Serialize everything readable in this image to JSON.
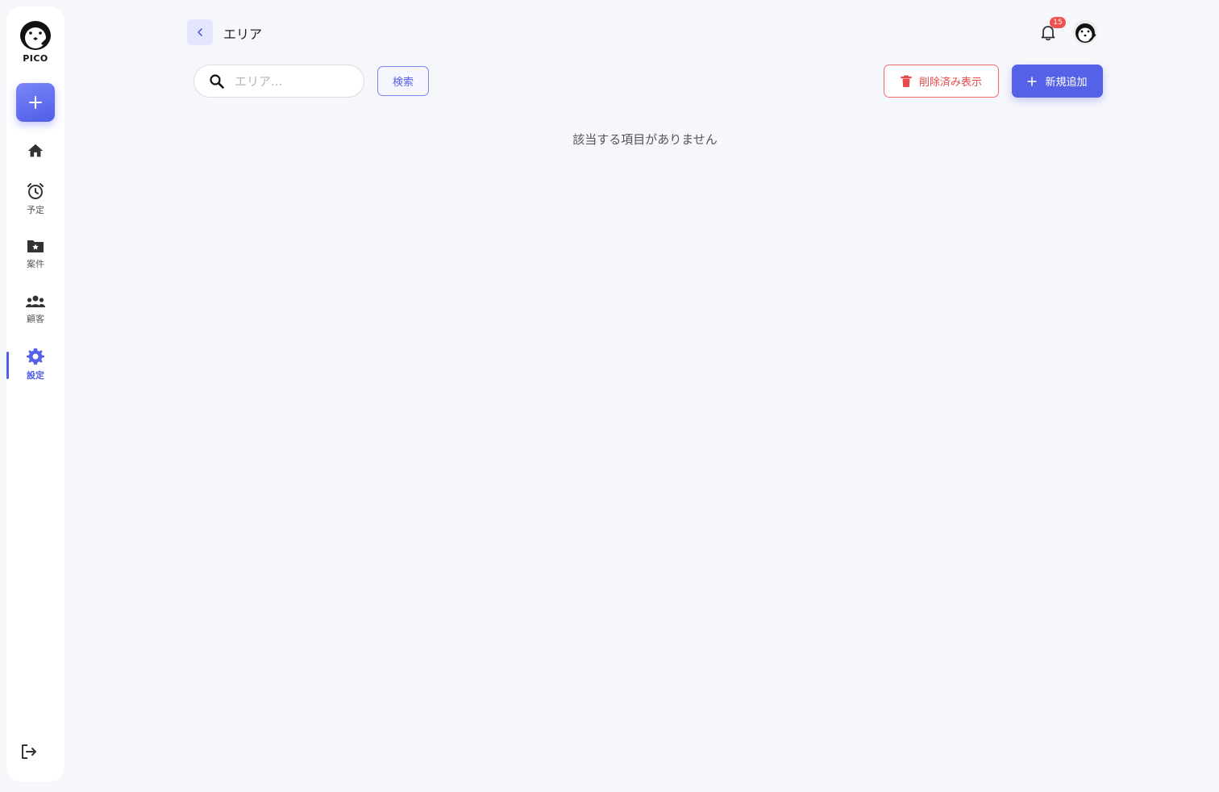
{
  "app": {
    "logo_text": "PICO",
    "accent_color": "#5561e6"
  },
  "sidebar": {
    "items": [
      {
        "name": "home",
        "icon": "home-icon",
        "label": ""
      },
      {
        "name": "schedule",
        "icon": "alarm-clock-icon",
        "label": "予定"
      },
      {
        "name": "projects",
        "icon": "folder-star-icon",
        "label": "案件"
      },
      {
        "name": "customers",
        "icon": "people-icon",
        "label": "顧客"
      },
      {
        "name": "settings",
        "icon": "gear-icon",
        "label": "設定",
        "active": true
      }
    ],
    "logout_icon": "logout-icon"
  },
  "header": {
    "title": "エリア",
    "notification_count": "15"
  },
  "toolbar": {
    "search_placeholder": "エリア...",
    "search_value": "",
    "search_label": "検索",
    "show_deleted_label": "削除済み表示",
    "add_new_label": "新規追加"
  },
  "main": {
    "empty_message": "該当する項目がありません"
  }
}
